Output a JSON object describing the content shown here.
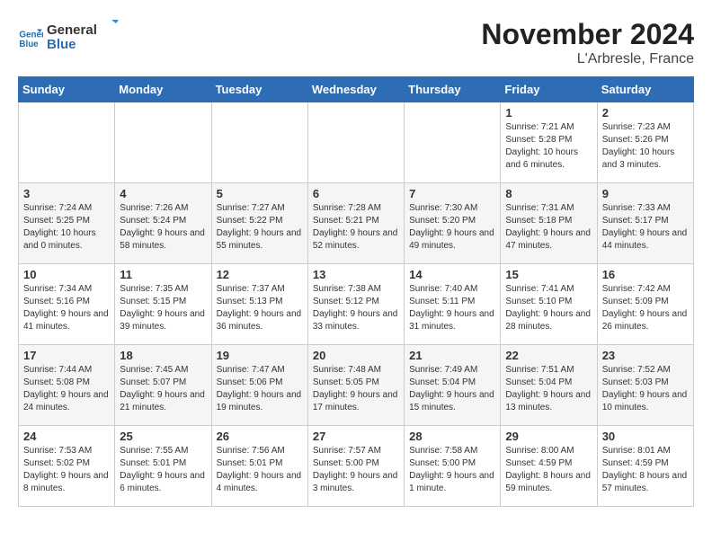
{
  "header": {
    "logo_line1": "General",
    "logo_line2": "Blue",
    "month": "November 2024",
    "location": "L'Arbresle, France"
  },
  "weekdays": [
    "Sunday",
    "Monday",
    "Tuesday",
    "Wednesday",
    "Thursday",
    "Friday",
    "Saturday"
  ],
  "weeks": [
    [
      {
        "day": "",
        "info": ""
      },
      {
        "day": "",
        "info": ""
      },
      {
        "day": "",
        "info": ""
      },
      {
        "day": "",
        "info": ""
      },
      {
        "day": "",
        "info": ""
      },
      {
        "day": "1",
        "info": "Sunrise: 7:21 AM\nSunset: 5:28 PM\nDaylight: 10 hours and 6 minutes."
      },
      {
        "day": "2",
        "info": "Sunrise: 7:23 AM\nSunset: 5:26 PM\nDaylight: 10 hours and 3 minutes."
      }
    ],
    [
      {
        "day": "3",
        "info": "Sunrise: 7:24 AM\nSunset: 5:25 PM\nDaylight: 10 hours and 0 minutes."
      },
      {
        "day": "4",
        "info": "Sunrise: 7:26 AM\nSunset: 5:24 PM\nDaylight: 9 hours and 58 minutes."
      },
      {
        "day": "5",
        "info": "Sunrise: 7:27 AM\nSunset: 5:22 PM\nDaylight: 9 hours and 55 minutes."
      },
      {
        "day": "6",
        "info": "Sunrise: 7:28 AM\nSunset: 5:21 PM\nDaylight: 9 hours and 52 minutes."
      },
      {
        "day": "7",
        "info": "Sunrise: 7:30 AM\nSunset: 5:20 PM\nDaylight: 9 hours and 49 minutes."
      },
      {
        "day": "8",
        "info": "Sunrise: 7:31 AM\nSunset: 5:18 PM\nDaylight: 9 hours and 47 minutes."
      },
      {
        "day": "9",
        "info": "Sunrise: 7:33 AM\nSunset: 5:17 PM\nDaylight: 9 hours and 44 minutes."
      }
    ],
    [
      {
        "day": "10",
        "info": "Sunrise: 7:34 AM\nSunset: 5:16 PM\nDaylight: 9 hours and 41 minutes."
      },
      {
        "day": "11",
        "info": "Sunrise: 7:35 AM\nSunset: 5:15 PM\nDaylight: 9 hours and 39 minutes."
      },
      {
        "day": "12",
        "info": "Sunrise: 7:37 AM\nSunset: 5:13 PM\nDaylight: 9 hours and 36 minutes."
      },
      {
        "day": "13",
        "info": "Sunrise: 7:38 AM\nSunset: 5:12 PM\nDaylight: 9 hours and 33 minutes."
      },
      {
        "day": "14",
        "info": "Sunrise: 7:40 AM\nSunset: 5:11 PM\nDaylight: 9 hours and 31 minutes."
      },
      {
        "day": "15",
        "info": "Sunrise: 7:41 AM\nSunset: 5:10 PM\nDaylight: 9 hours and 28 minutes."
      },
      {
        "day": "16",
        "info": "Sunrise: 7:42 AM\nSunset: 5:09 PM\nDaylight: 9 hours and 26 minutes."
      }
    ],
    [
      {
        "day": "17",
        "info": "Sunrise: 7:44 AM\nSunset: 5:08 PM\nDaylight: 9 hours and 24 minutes."
      },
      {
        "day": "18",
        "info": "Sunrise: 7:45 AM\nSunset: 5:07 PM\nDaylight: 9 hours and 21 minutes."
      },
      {
        "day": "19",
        "info": "Sunrise: 7:47 AM\nSunset: 5:06 PM\nDaylight: 9 hours and 19 minutes."
      },
      {
        "day": "20",
        "info": "Sunrise: 7:48 AM\nSunset: 5:05 PM\nDaylight: 9 hours and 17 minutes."
      },
      {
        "day": "21",
        "info": "Sunrise: 7:49 AM\nSunset: 5:04 PM\nDaylight: 9 hours and 15 minutes."
      },
      {
        "day": "22",
        "info": "Sunrise: 7:51 AM\nSunset: 5:04 PM\nDaylight: 9 hours and 13 minutes."
      },
      {
        "day": "23",
        "info": "Sunrise: 7:52 AM\nSunset: 5:03 PM\nDaylight: 9 hours and 10 minutes."
      }
    ],
    [
      {
        "day": "24",
        "info": "Sunrise: 7:53 AM\nSunset: 5:02 PM\nDaylight: 9 hours and 8 minutes."
      },
      {
        "day": "25",
        "info": "Sunrise: 7:55 AM\nSunset: 5:01 PM\nDaylight: 9 hours and 6 minutes."
      },
      {
        "day": "26",
        "info": "Sunrise: 7:56 AM\nSunset: 5:01 PM\nDaylight: 9 hours and 4 minutes."
      },
      {
        "day": "27",
        "info": "Sunrise: 7:57 AM\nSunset: 5:00 PM\nDaylight: 9 hours and 3 minutes."
      },
      {
        "day": "28",
        "info": "Sunrise: 7:58 AM\nSunset: 5:00 PM\nDaylight: 9 hours and 1 minute."
      },
      {
        "day": "29",
        "info": "Sunrise: 8:00 AM\nSunset: 4:59 PM\nDaylight: 8 hours and 59 minutes."
      },
      {
        "day": "30",
        "info": "Sunrise: 8:01 AM\nSunset: 4:59 PM\nDaylight: 8 hours and 57 minutes."
      }
    ]
  ]
}
